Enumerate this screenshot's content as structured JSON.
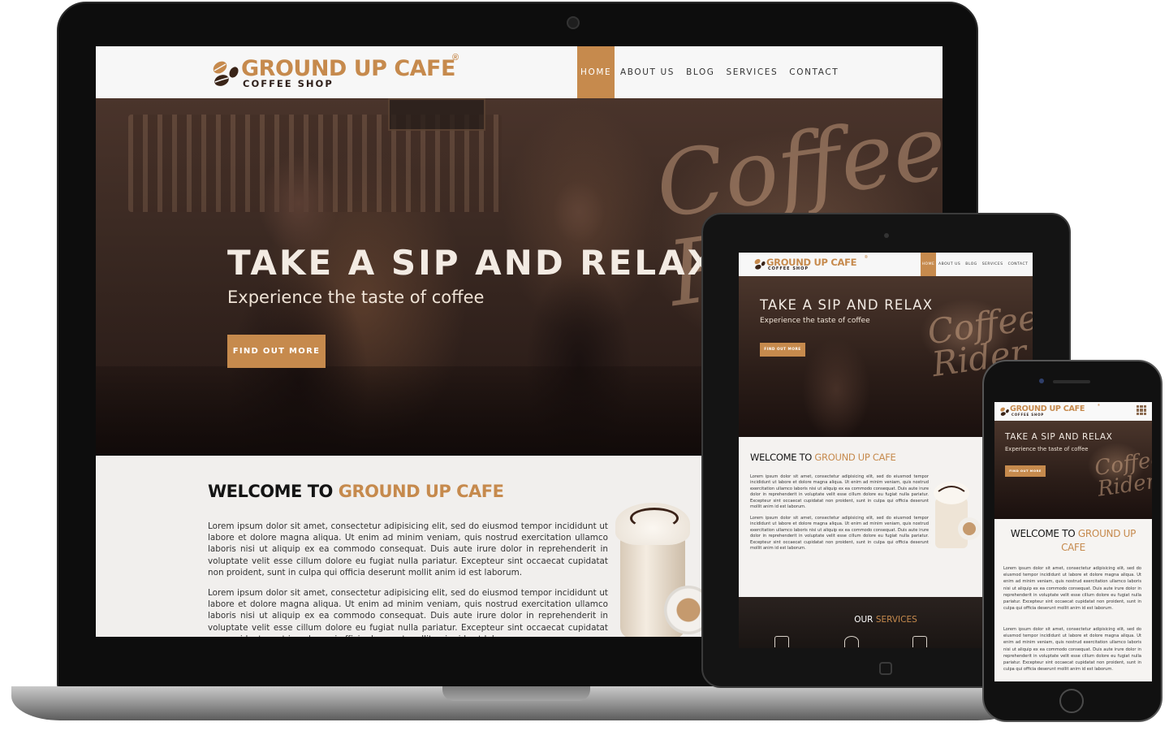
{
  "brand": {
    "name": "GROUND UP CAFE",
    "registered": "®",
    "tagline": "COFFEE SHOP",
    "accent_color": "#c68a4d",
    "dark_color": "#2e1f1a"
  },
  "nav": {
    "items": [
      {
        "label": "HOME",
        "active": true
      },
      {
        "label": "ABOUT US",
        "active": false
      },
      {
        "label": "BLOG",
        "active": false
      },
      {
        "label": "SERVICES",
        "active": false
      },
      {
        "label": "CONTACT",
        "active": false
      }
    ]
  },
  "hero": {
    "title": "TAKE A SIP AND RELAX",
    "subtitle": "Experience the taste of coffee",
    "button_label": "FIND OUT MORE",
    "sign_text": "Coffee Rider"
  },
  "welcome": {
    "title_prefix": "WELCOME TO ",
    "title_accent": "GROUND UP CAFE",
    "paragraphs": [
      "Lorem ipsum dolor sit amet, consectetur adipisicing elit, sed do eiusmod tempor incididunt ut labore et dolore magna aliqua. Ut enim ad minim veniam, quis nostrud exercitation ullamco laboris nisi ut aliquip ex ea commodo consequat. Duis aute irure dolor in reprehenderit in voluptate velit esse cillum dolore eu fugiat nulla pariatur. Excepteur sint occaecat cupidatat non proident, sunt in culpa qui officia deserunt mollit anim id est laborum.",
      "Lorem ipsum dolor sit amet, consectetur adipisicing elit, sed do eiusmod tempor incididunt ut labore et dolore magna aliqua. Ut enim ad minim veniam, quis nostrud exercitation ullamco laboris nisi ut aliquip ex ea commodo consequat. Duis aute irure dolor in reprehenderit in voluptate velit esse cillum dolore eu fugiat nulla pariatur. Excepteur sint occaecat cupidatat non proident, sunt in culpa qui officia deserunt mollit anim id est laborum."
    ]
  },
  "services": {
    "title_prefix": "OUR ",
    "title_accent": "SERVICES",
    "icons": [
      "coffee-machine-icon",
      "coffee-beans-icon",
      "cafe-storefront-icon"
    ]
  },
  "devices": [
    "laptop",
    "tablet",
    "phone"
  ]
}
